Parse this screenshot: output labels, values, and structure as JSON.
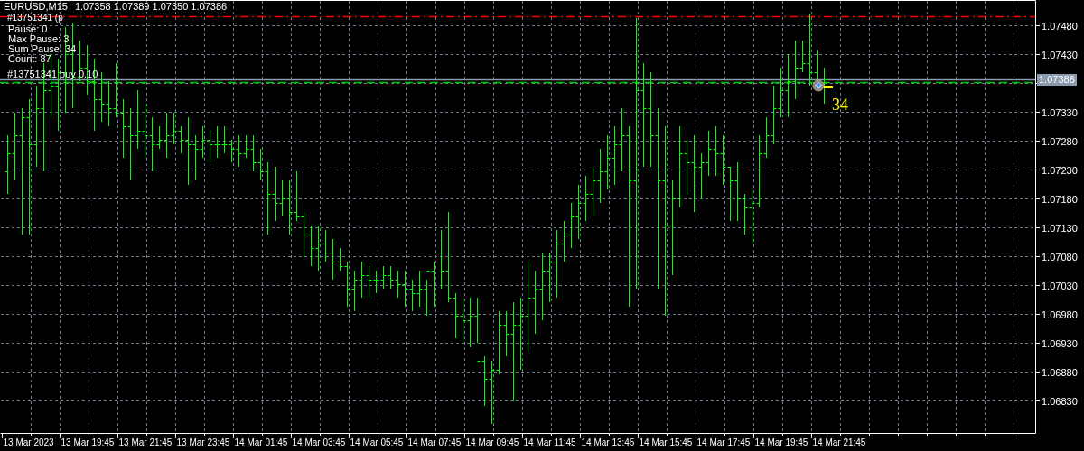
{
  "chart": {
    "symbol": "EURUSD,M15",
    "ohlc_readout": "1.07358 1.07389 1.07350 1.07386",
    "overlay_label": "#13751341 (p",
    "info_lines": [
      "Pause: 0",
      "Max Pause: 3",
      "Sum Pause: 34",
      "Count: 87"
    ],
    "order_label": "#13751341 buy 0.10",
    "bid_price_label": "1.07386",
    "marker_label": "34",
    "price_axis": [
      "1.07480",
      "1.07430",
      "1.07330",
      "1.07280",
      "1.07230",
      "1.07180",
      "1.07130",
      "1.07080",
      "1.07030",
      "1.06980",
      "1.06930",
      "1.06880",
      "1.06830"
    ],
    "time_axis": [
      "13 Mar 2023",
      "13 Mar 19:45",
      "13 Mar 21:45",
      "13 Mar 23:45",
      "14 Mar 01:45",
      "14 Mar 03:45",
      "14 Mar 05:45",
      "14 Mar 07:45",
      "14 Mar 09:45",
      "14 Mar 11:45",
      "14 Mar 13:45",
      "14 Mar 15:45",
      "14 Mar 17:45",
      "14 Mar 19:45",
      "14 Mar 21:45"
    ]
  }
}
